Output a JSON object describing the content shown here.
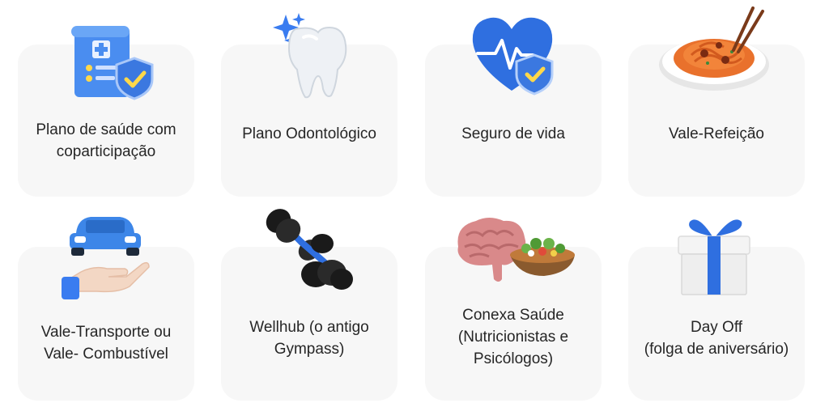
{
  "benefits": [
    {
      "icon": "health-plan-document-shield-icon",
      "lines": [
        "Plano de saúde com",
        "coparticipação"
      ]
    },
    {
      "icon": "tooth-icon",
      "lines": [
        "Plano Odontológico"
      ]
    },
    {
      "icon": "heart-shield-icon",
      "lines": [
        "Seguro de vida"
      ]
    },
    {
      "icon": "pasta-plate-icon",
      "lines": [
        "Vale-Refeição"
      ]
    },
    {
      "icon": "car-hand-icon",
      "lines": [
        "Vale-Transporte ou",
        "Vale- Combustível"
      ]
    },
    {
      "icon": "dumbbells-icon",
      "lines": [
        "Wellhub (o antigo",
        "Gympass)"
      ]
    },
    {
      "icon": "brain-salad-icon",
      "lines": [
        "Conexa Saúde",
        "(Nutricionistas e",
        "Psicólogos)"
      ]
    },
    {
      "icon": "gift-box-icon",
      "lines": [
        "Day Off",
        "(folga de aniversário)"
      ]
    }
  ],
  "colors": {
    "card": "#f7f7f7",
    "text": "#262626",
    "accent_blue": "#2f6fe0"
  }
}
